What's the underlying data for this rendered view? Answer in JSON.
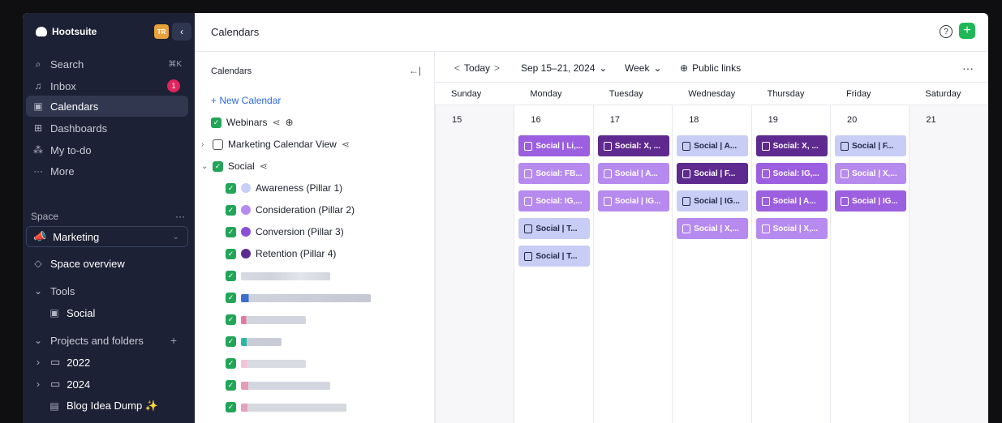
{
  "sidebar": {
    "brand": "Hootsuite",
    "avatar_initials": "TR",
    "nav": [
      {
        "label": "Search",
        "icon": "search-icon",
        "shortcut": "⌘K"
      },
      {
        "label": "Inbox",
        "icon": "bell-icon",
        "badge": "1"
      },
      {
        "label": "Calendars",
        "icon": "calendar-icon",
        "active": true
      },
      {
        "label": "Dashboards",
        "icon": "dashboard-icon"
      },
      {
        "label": "My to-do",
        "icon": "todo-icon"
      },
      {
        "label": "More",
        "icon": "more-icon"
      }
    ],
    "space_label": "Space",
    "space_selected": "Marketing",
    "space_overview": "Space overview",
    "tools_label": "Tools",
    "tools_social": "Social",
    "projects_label": "Projects and folders",
    "folders": [
      "2022",
      "2024"
    ],
    "blog_item": "Blog Idea Dump ✨"
  },
  "header": {
    "title": "Calendars",
    "help": "?",
    "add": "+"
  },
  "calendars_panel": {
    "title": "Calendars",
    "new_calendar": "+ New Calendar",
    "webinars": "Webinars",
    "marketing_view": "Marketing Calendar View",
    "social": "Social",
    "pillars": [
      {
        "label": "Awareness (Pillar 1)",
        "color": "#c9cef5"
      },
      {
        "label": "Consideration (Pillar 2)",
        "color": "#b68aef"
      },
      {
        "label": "Conversion (Pillar 3)",
        "color": "#8b4fd6"
      },
      {
        "label": "Retention (Pillar 4)",
        "color": "#5e2a8f"
      }
    ]
  },
  "toolbar": {
    "prev": "<",
    "today": "Today",
    "next": ">",
    "range": "Sep 15–21, 2024",
    "view": "Week",
    "public_links": "Public links",
    "more": "···"
  },
  "days": [
    {
      "name": "Sunday",
      "num": "15",
      "events": []
    },
    {
      "name": "Monday",
      "num": "16",
      "events": [
        {
          "label": "Social | Li,...",
          "style": "pur"
        },
        {
          "label": "Social: FB...",
          "style": "mid"
        },
        {
          "label": "Social: IG,...",
          "style": "mid"
        },
        {
          "label": "Social | T...",
          "style": "lav"
        },
        {
          "label": "Social | T...",
          "style": "lav"
        }
      ]
    },
    {
      "name": "Tuesday",
      "num": "17",
      "events": [
        {
          "label": "Social: X, ...",
          "style": "dk"
        },
        {
          "label": "Social | A...",
          "style": "mid"
        },
        {
          "label": "Social | IG...",
          "style": "mid"
        }
      ]
    },
    {
      "name": "Wednesday",
      "num": "18",
      "events": [
        {
          "label": "Social | A...",
          "style": "lav"
        },
        {
          "label": "Social | F...",
          "style": "dk"
        },
        {
          "label": "Social | IG...",
          "style": "lav"
        },
        {
          "label": "Social | X,...",
          "style": "mid"
        }
      ]
    },
    {
      "name": "Thursday",
      "num": "19",
      "events": [
        {
          "label": "Social: X, ...",
          "style": "dk"
        },
        {
          "label": "Social: IG,...",
          "style": "pur"
        },
        {
          "label": "Social | A...",
          "style": "pur"
        },
        {
          "label": "Social | X,...",
          "style": "mid"
        }
      ]
    },
    {
      "name": "Friday",
      "num": "20",
      "events": [
        {
          "label": "Social | F...",
          "style": "lav"
        },
        {
          "label": "Social | X,...",
          "style": "mid"
        },
        {
          "label": "Social | IG...",
          "style": "pur"
        }
      ]
    },
    {
      "name": "Saturday",
      "num": "21",
      "events": []
    }
  ]
}
